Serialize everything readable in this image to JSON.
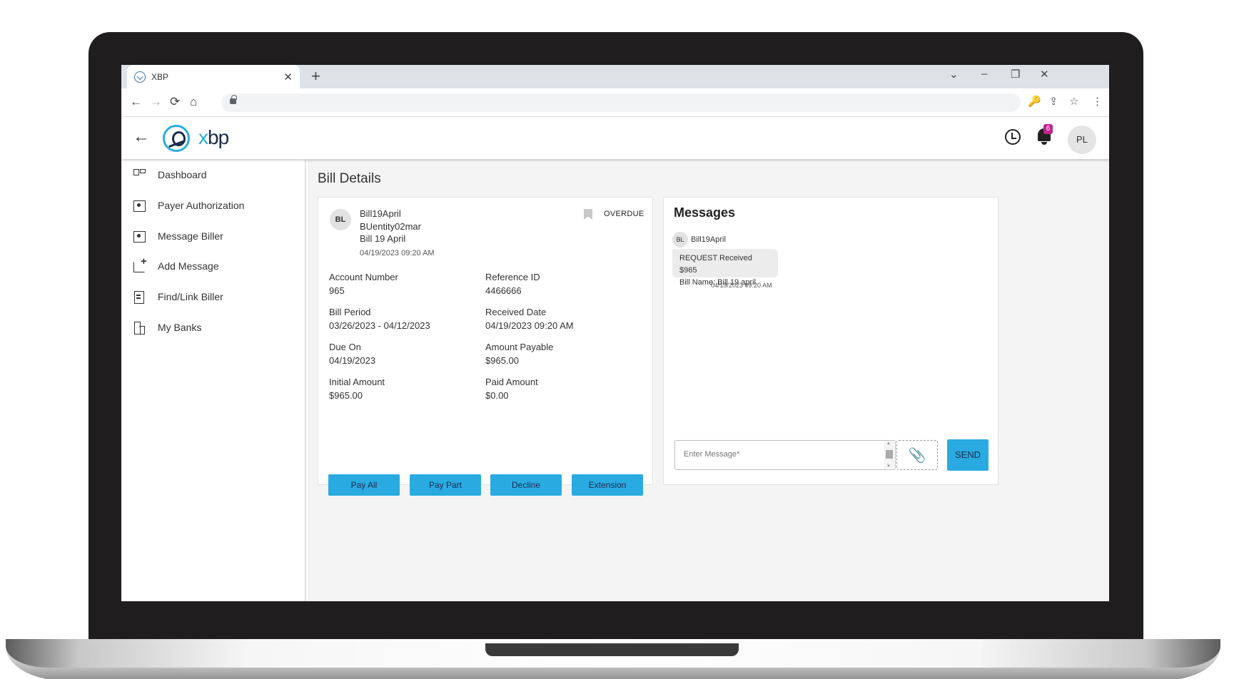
{
  "browser": {
    "tab_title": "XBP",
    "new_tab": "+",
    "tab_close": "✕",
    "win_controls": [
      "⌄",
      "–",
      "❐",
      "✕"
    ],
    "nav": [
      "←",
      "→",
      "⟳",
      "⌂"
    ],
    "toolbar_icons": [
      "🔑",
      "⇪",
      "☆",
      "⋮"
    ]
  },
  "header": {
    "back": "←",
    "logo_x": "x",
    "logo_rest": "bp",
    "notification_count": "6",
    "user_initials": "PL"
  },
  "sidebar": {
    "items": [
      {
        "label": "Dashboard"
      },
      {
        "label": "Payer Authorization"
      },
      {
        "label": "Message Biller"
      },
      {
        "label": "Add Message"
      },
      {
        "label": "Find/Link Biller"
      },
      {
        "label": "My Banks"
      }
    ]
  },
  "main": {
    "title": "Bill Details",
    "bill": {
      "avatar": "BL",
      "name": "Bill19April",
      "entity": "BUentity02mar",
      "description": "Bill 19 April",
      "datetime": "04/19/2023 09:20 AM",
      "status": "OVERDUE",
      "fields": [
        {
          "label": "Account Number",
          "value": "965"
        },
        {
          "label": "Reference ID",
          "value": "4466666"
        },
        {
          "label": "Bill Period",
          "value": "03/26/2023 - 04/12/2023"
        },
        {
          "label": "Received Date",
          "value": "04/19/2023 09:20 AM"
        },
        {
          "label": "Due On",
          "value": "04/19/2023"
        },
        {
          "label": "Amount Payable",
          "value": "$965.00"
        },
        {
          "label": "Initial Amount",
          "value": "$965.00"
        },
        {
          "label": "Paid Amount",
          "value": "$0.00"
        }
      ],
      "actions": [
        "Pay All",
        "Pay Part",
        "Decline",
        "Extension"
      ]
    },
    "messages": {
      "title": "Messages",
      "sender_avatar": "BL",
      "sender": "Bill19April",
      "message_line1": "REQUEST Received $965",
      "message_line2": "Bill Name: Bill 19 april",
      "time": "04/19/2023 09:20 AM",
      "input_placeholder": "Enter Message*",
      "attach_icon": "📎",
      "send_label": "SEND"
    }
  },
  "colors": {
    "accent": "#29abe2",
    "brand_dark": "#1d2b4a",
    "badge": "#c2238e"
  }
}
